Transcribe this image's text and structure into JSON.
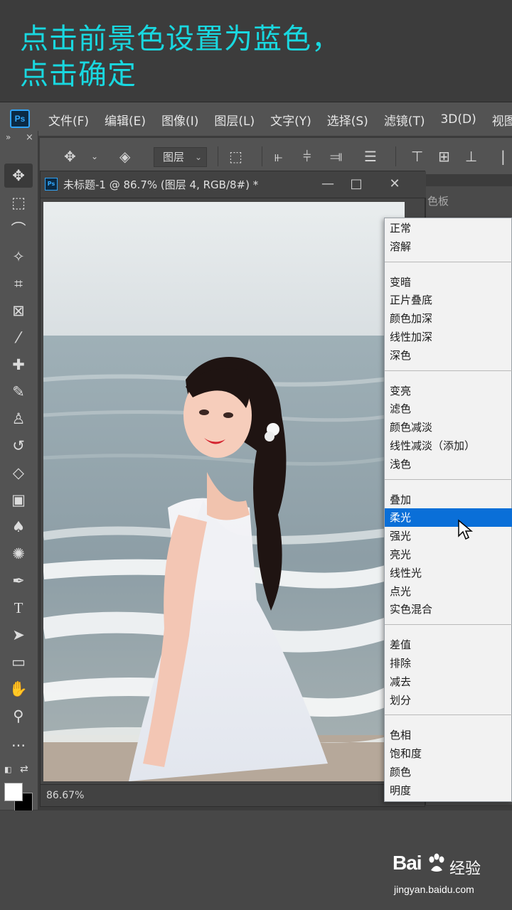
{
  "caption": {
    "line1": "点击前景色设置为蓝色，",
    "line2": "点击确定"
  },
  "menubar": {
    "app_icon": "Ps",
    "items": [
      "文件(F)",
      "编辑(E)",
      "图像(I)",
      "图层(L)",
      "文字(Y)",
      "选择(S)",
      "滤镜(T)",
      "3D(D)",
      "视图"
    ]
  },
  "options_bar": {
    "auto_select_value": "图层",
    "icons": [
      "move-icon",
      "layer-stack-icon",
      "transform-controls-icon",
      "align-left-icon",
      "align-center-icon",
      "align-right-icon",
      "align-middle-icon",
      "distribute-top-icon",
      "distribute-vcenter-icon",
      "distribute-bottom-icon"
    ]
  },
  "toolbar": {
    "header": "»",
    "close": "×",
    "tools": [
      "move-tool",
      "marquee-tool",
      "lasso-tool",
      "magic-wand-tool",
      "crop-tool",
      "frame-tool",
      "eyedropper-tool",
      "healing-brush-tool",
      "brush-tool",
      "clone-stamp-tool",
      "history-brush-tool",
      "eraser-tool",
      "gradient-tool",
      "blur-tool",
      "dodge-tool",
      "pen-tool",
      "type-tool",
      "path-selection-tool",
      "rectangle-tool",
      "hand-tool",
      "zoom-tool",
      "more-tools"
    ],
    "foreground_color": "#ffffff",
    "background_color": "#000000"
  },
  "document": {
    "icon": "Ps",
    "title": "未标题-1 @ 86.7% (图层 4, RGB/8#) *",
    "zoom": "86.67%"
  },
  "right_panel": {
    "title": "色板"
  },
  "blend_menu": {
    "selected": "柔光",
    "groups": [
      [
        "正常",
        "溶解"
      ],
      [
        "变暗",
        "正片叠底",
        "颜色加深",
        "线性加深",
        "深色"
      ],
      [
        "变亮",
        "滤色",
        "颜色减淡",
        "线性减淡（添加）",
        "浅色"
      ],
      [
        "叠加",
        "柔光",
        "强光",
        "亮光",
        "线性光",
        "点光",
        "实色混合"
      ],
      [
        "差值",
        "排除",
        "减去",
        "划分"
      ],
      [
        "色相",
        "饱和度",
        "颜色",
        "明度"
      ]
    ]
  },
  "watermark": {
    "brand": "Bai",
    "brand_cn": "经验",
    "url": "jingyan.baidu.com"
  }
}
